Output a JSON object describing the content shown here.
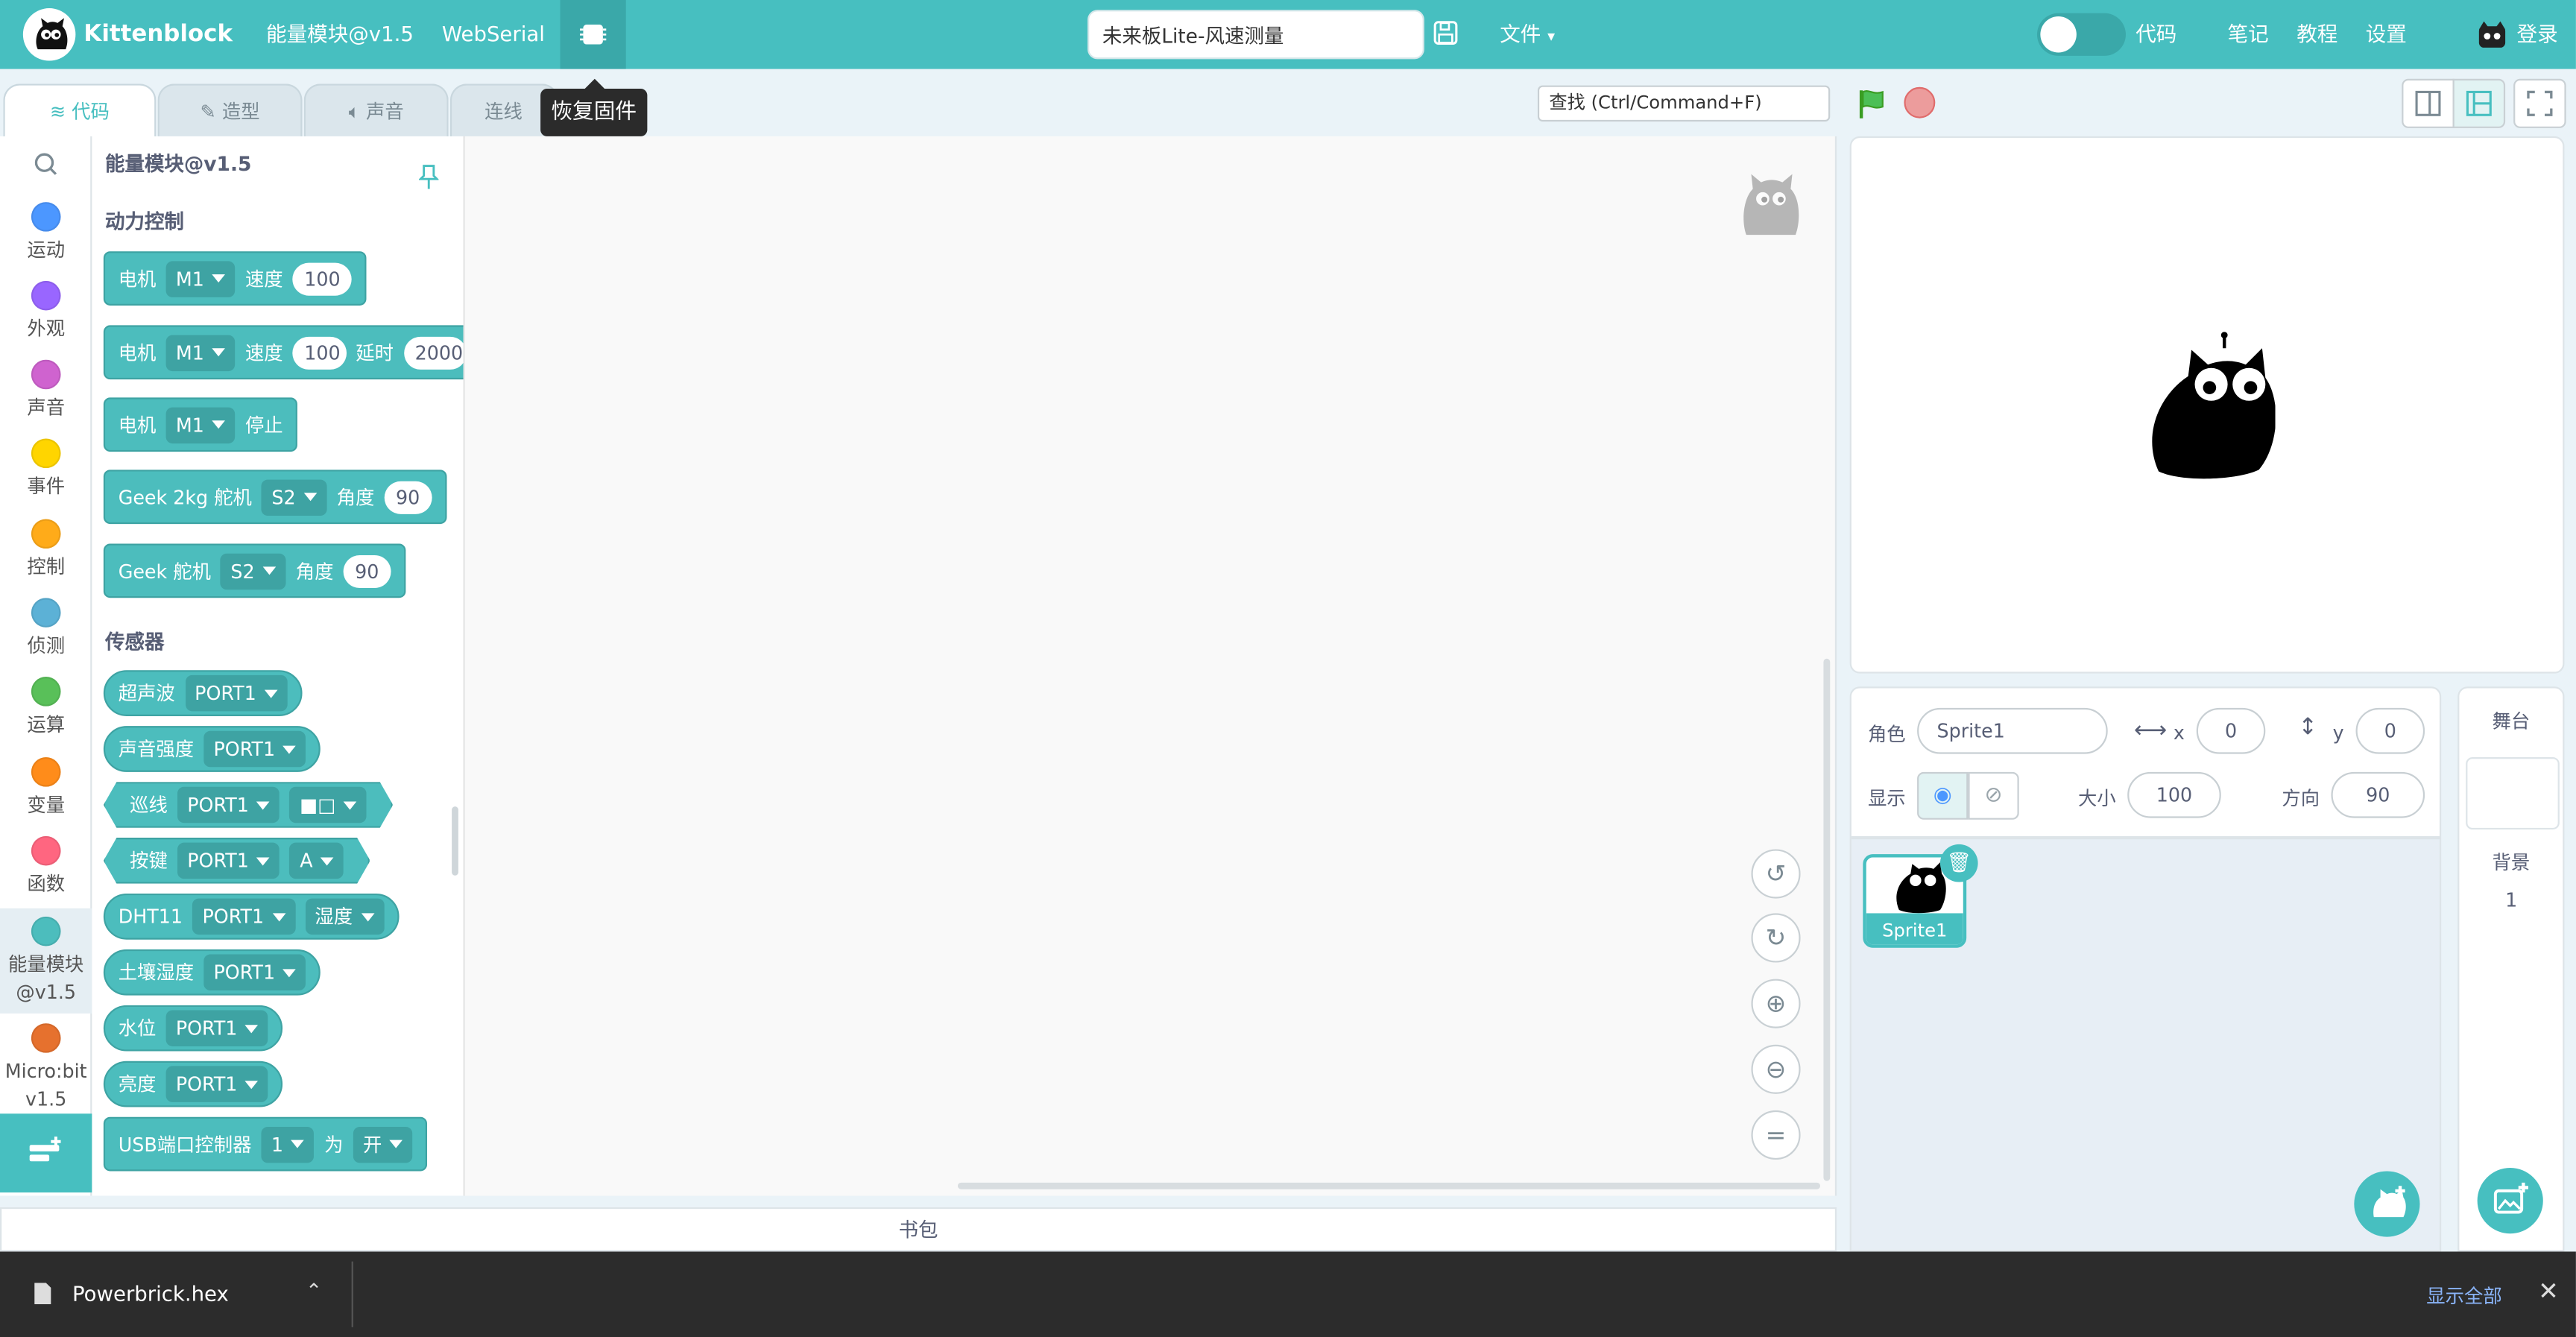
{
  "menubar": {
    "brand": "Kittenblock",
    "device": "能量模块@v1.5",
    "connection": "WebSerial",
    "project_name": "未来板Lite-风速测量",
    "file_menu": "文件",
    "code_label": "代码",
    "notes": "笔记",
    "tutorials": "教程",
    "settings": "设置",
    "login": "登录"
  },
  "tooltip": "恢复固件",
  "tabs": [
    "代码",
    "造型",
    "声音",
    "连线"
  ],
  "search_placeholder": "查找 (Ctrl/Command+F)",
  "categories": [
    {
      "label": "运动",
      "color": "#4c97ff"
    },
    {
      "label": "外观",
      "color": "#9966ff"
    },
    {
      "label": "声音",
      "color": "#cf63cf"
    },
    {
      "label": "事件",
      "color": "#ffd500"
    },
    {
      "label": "控制",
      "color": "#ffab19"
    },
    {
      "label": "侦测",
      "color": "#5cb1d6"
    },
    {
      "label": "运算",
      "color": "#59c059"
    },
    {
      "label": "变量",
      "color": "#ff8c1a"
    },
    {
      "label": "函数",
      "color": "#ff6680"
    },
    {
      "label": "能量模块@v1.5",
      "color": "#4cbdbd"
    },
    {
      "label": "Micro:bit v1.5",
      "color": "#e6712e"
    }
  ],
  "palette": {
    "title": "能量模块@v1.5",
    "section_power": "动力控制",
    "section_sensor": "传感器",
    "blocks": {
      "motor1": {
        "a": "电机",
        "port": "M1",
        "b": "速度",
        "speed": "100"
      },
      "motor2": {
        "a": "电机",
        "port": "M1",
        "b": "速度",
        "speed": "100",
        "c": "延时",
        "delay": "2000"
      },
      "motor3": {
        "a": "电机",
        "port": "M1",
        "b": "停止"
      },
      "servo1": {
        "a": "Geek 2kg 舵机",
        "port": "S2",
        "b": "角度",
        "angle": "90"
      },
      "servo2": {
        "a": "Geek 舵机",
        "port": "S2",
        "b": "角度",
        "angle": "90"
      },
      "ultra": {
        "a": "超声波",
        "port": "PORT1"
      },
      "sound": {
        "a": "声音强度",
        "port": "PORT1"
      },
      "line": {
        "a": "巡线",
        "port": "PORT1",
        "opt": "■□"
      },
      "key": {
        "a": "按键",
        "port": "PORT1",
        "opt": "A"
      },
      "dht": {
        "a": "DHT11",
        "port": "PORT1",
        "opt": "湿度"
      },
      "soil": {
        "a": "土壤湿度",
        "port": "PORT1"
      },
      "water": {
        "a": "水位",
        "port": "PORT1"
      },
      "light": {
        "a": "亮度",
        "port": "PORT1"
      },
      "usb": {
        "a": "USB端口控制器",
        "port": "1",
        "b": "为",
        "opt": "开"
      }
    }
  },
  "backpack": "书包",
  "sprite_info": {
    "sprite_label": "角色",
    "sprite_name": "Sprite1",
    "x_label": "x",
    "x": "0",
    "y_label": "y",
    "y": "0",
    "show_label": "显示",
    "size_label": "大小",
    "size": "100",
    "direction_label": "方向",
    "direction": "90"
  },
  "sprites": [
    {
      "name": "Sprite1"
    }
  ],
  "stage_panel": {
    "title": "舞台",
    "backdrop_label": "背景",
    "backdrop_count": "1"
  },
  "download_bar": {
    "file": "Powerbrick.hex",
    "show_all": "显示全部"
  }
}
